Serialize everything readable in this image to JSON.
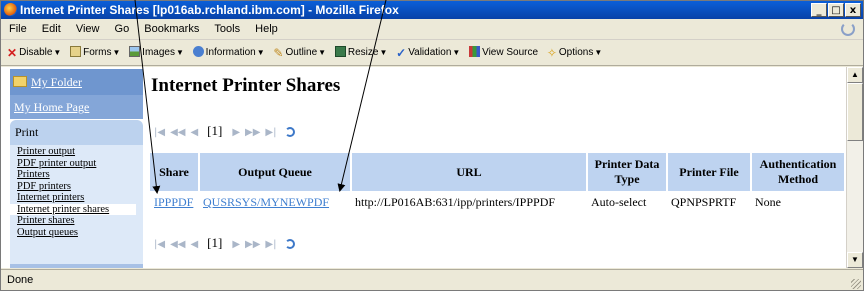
{
  "window": {
    "title": "Internet Printer Shares [lp016ab.rchland.ibm.com] - Mozilla Firefox",
    "buttons": [
      "_",
      "□",
      "x"
    ]
  },
  "menubar": [
    "File",
    "Edit",
    "View",
    "Go",
    "Bookmarks",
    "Tools",
    "Help"
  ],
  "toolbar": [
    {
      "label": "Disable",
      "icon": "red-x-icon"
    },
    {
      "label": "Forms",
      "icon": "forms-icon"
    },
    {
      "label": "Images",
      "icon": "images-icon"
    },
    {
      "label": "Information",
      "icon": "info-icon"
    },
    {
      "label": "Outline",
      "icon": "pencil-icon"
    },
    {
      "label": "Resize",
      "icon": "resize-icon"
    },
    {
      "label": "Validation",
      "icon": "check-icon"
    },
    {
      "label": "View Source",
      "icon": "source-icon"
    },
    {
      "label": "Options",
      "icon": "wand-icon"
    }
  ],
  "sidebar": {
    "folder": "My Folder",
    "home": "My Home Page",
    "section": "Print",
    "items": [
      "Printer output",
      "PDF printer output",
      "Printers",
      "PDF printers",
      "Internet printers",
      "Internet printer shares",
      "Printer shares",
      "Output queues"
    ],
    "active_index": 5
  },
  "main": {
    "heading": "Internet Printer Shares",
    "pager": {
      "page": "[1]"
    },
    "table": {
      "columns": [
        "Share",
        "Output Queue",
        "URL",
        "Printer Data Type",
        "Printer File",
        "Authentication Method"
      ],
      "rows": [
        {
          "share": "IPPPDF",
          "output_queue": "QUSRSYS/MYNEWPDF",
          "url": "http://LP016AB:631/ipp/printers/IPPPDF",
          "data_type": "Auto-select",
          "printer_file": "QPNPSPRTF",
          "auth": "None"
        }
      ]
    }
  },
  "status": {
    "text": "Done"
  },
  "colors": {
    "titlebar": "#0a5fd8",
    "table_header": "#bed3f0",
    "link": "#3f7fd0",
    "sidebar_dark": "#6f96cf"
  }
}
